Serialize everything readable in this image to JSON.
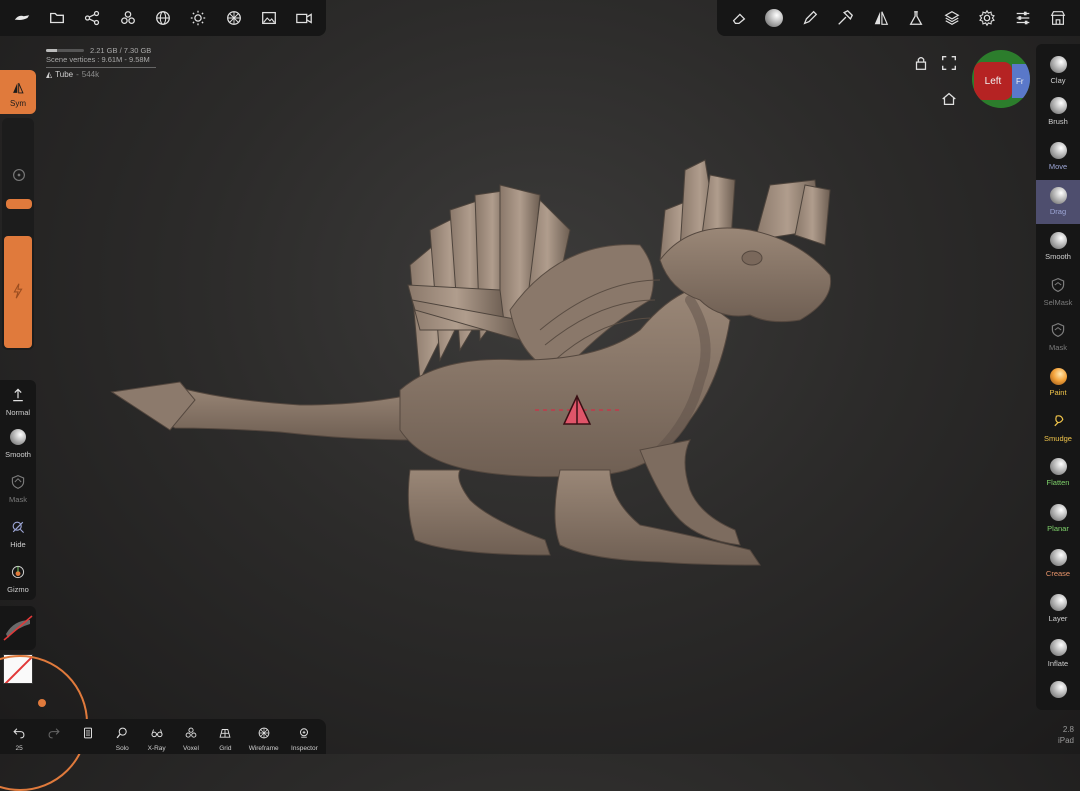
{
  "stats": {
    "memory_text": "2.21 GB / 7.30 GB",
    "memory_fraction": 0.3,
    "scene_vertices_text": "Scene vertices : 9.61M - 9.58M"
  },
  "mesh": {
    "name": "Tube",
    "count": "544k"
  },
  "left_panel": {
    "sym_label": "Sym",
    "radius_fraction": 0.86,
    "intensity_fraction": 1.0,
    "tools": [
      {
        "label": "Normal",
        "icon": "upload-arrow-icon",
        "dim": false
      },
      {
        "label": "Smooth",
        "icon": "smooth-sphere-icon",
        "dim": false
      },
      {
        "label": "Mask",
        "icon": "mask-shield-icon",
        "dim": true
      },
      {
        "label": "Hide",
        "icon": "hide-icon",
        "dim": false
      },
      {
        "label": "Gizmo",
        "icon": "gizmo-icon",
        "dim": false
      }
    ]
  },
  "bottom_bar": [
    {
      "label": "25",
      "icon": "undo-icon",
      "dim": false
    },
    {
      "label": "",
      "icon": "redo-icon",
      "dim": true
    },
    {
      "label": "",
      "icon": "history-icon",
      "dim": false
    },
    {
      "label": "Solo",
      "icon": "solo-search-icon",
      "dim": false
    },
    {
      "label": "X-Ray",
      "icon": "xray-glasses-icon",
      "dim": false
    },
    {
      "label": "Voxel",
      "icon": "voxel-icon",
      "dim": false
    },
    {
      "label": "Grid",
      "icon": "grid-icon",
      "dim": false
    },
    {
      "label": "Wireframe",
      "icon": "wireframe-icon",
      "dim": false
    },
    {
      "label": "Inspector",
      "icon": "inspector-icon",
      "dim": false
    }
  ],
  "brushes": [
    {
      "label": "Clay",
      "color": "#cfcfcf",
      "kind": "sphere"
    },
    {
      "label": "Brush",
      "color": "#cfcfcf",
      "kind": "sphere"
    },
    {
      "label": "Move",
      "color": "#9da6d6",
      "kind": "sphere"
    },
    {
      "label": "Drag",
      "color": "#9da6d6",
      "kind": "sphere",
      "selected": true
    },
    {
      "label": "Smooth",
      "color": "#cfcfcf",
      "kind": "sphere"
    },
    {
      "label": "SelMask",
      "color": "#7c7c7c",
      "kind": "shield"
    },
    {
      "label": "Mask",
      "color": "#7c7c7c",
      "kind": "shield"
    },
    {
      "label": "Paint",
      "color": "#f0c44a",
      "kind": "paint"
    },
    {
      "label": "Smudge",
      "color": "#f0c44a",
      "kind": "smudge"
    },
    {
      "label": "Flatten",
      "color": "#7fd36b",
      "kind": "sphere"
    },
    {
      "label": "Planar",
      "color": "#7fd36b",
      "kind": "sphere"
    },
    {
      "label": "Crease",
      "color": "#e8956b",
      "kind": "sphere"
    },
    {
      "label": "Layer",
      "color": "#cfcfcf",
      "kind": "sphere"
    },
    {
      "label": "Inflate",
      "color": "#cfcfcf",
      "kind": "sphere"
    },
    {
      "label": "",
      "color": "#cfcfcf",
      "kind": "sphere"
    }
  ],
  "view_cube": {
    "left_face": "Left",
    "front_face": "Fr"
  },
  "device": {
    "version": "2.8",
    "platform": "iPad"
  },
  "colors": {
    "accent": "#e07a3c",
    "selected_brush_bg": "#4e4e6e",
    "panel_bg": "#161616"
  }
}
